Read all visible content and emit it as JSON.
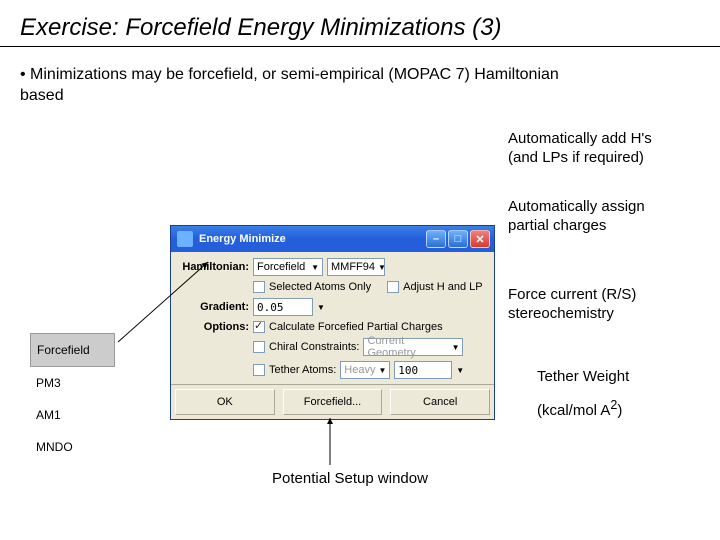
{
  "slide": {
    "title": "Exercise:  Forcefield Energy Minimizations (3)",
    "bullet": "• Minimizations may be forcefield, or semi-empirical (MOPAC 7) Hamiltonian based"
  },
  "annotations": {
    "addH": "Automatically add H's\n(and LPs if required)",
    "partial": "Automatically assign\npartial charges",
    "stereo": "Force current (R/S)\nstereochemistry",
    "tether": "Tether Weight",
    "unit_pre": "(kcal/mol A",
    "unit_sup": "2",
    "unit_post": ")",
    "caption": "Potential Setup window"
  },
  "sidelist": {
    "items": [
      "Forcefield",
      "PM3",
      "AM1",
      "MNDO"
    ]
  },
  "dialog": {
    "title": "Energy Minimize",
    "labels": {
      "hamiltonian": "Hamiltonian:",
      "gradient": "Gradient:",
      "options": "Options:"
    },
    "hamiltonian_value": "Forcefield",
    "hamiltonian_sub": "MMFF94",
    "selected_only": "Selected Atoms Only",
    "adjust_h": "Adjust H and LP",
    "gradient_value": "0.05",
    "calc_partial": "Calculate Forcefied Partial Charges",
    "chiral_label": "Chiral Constraints:",
    "chiral_value": "Current Geometry",
    "tether_label": "Tether Atoms:",
    "tether_value": "Heavy",
    "tether_weight": "100",
    "buttons": {
      "ok": "OK",
      "forcefield": "Forcefield...",
      "cancel": "Cancel"
    }
  }
}
